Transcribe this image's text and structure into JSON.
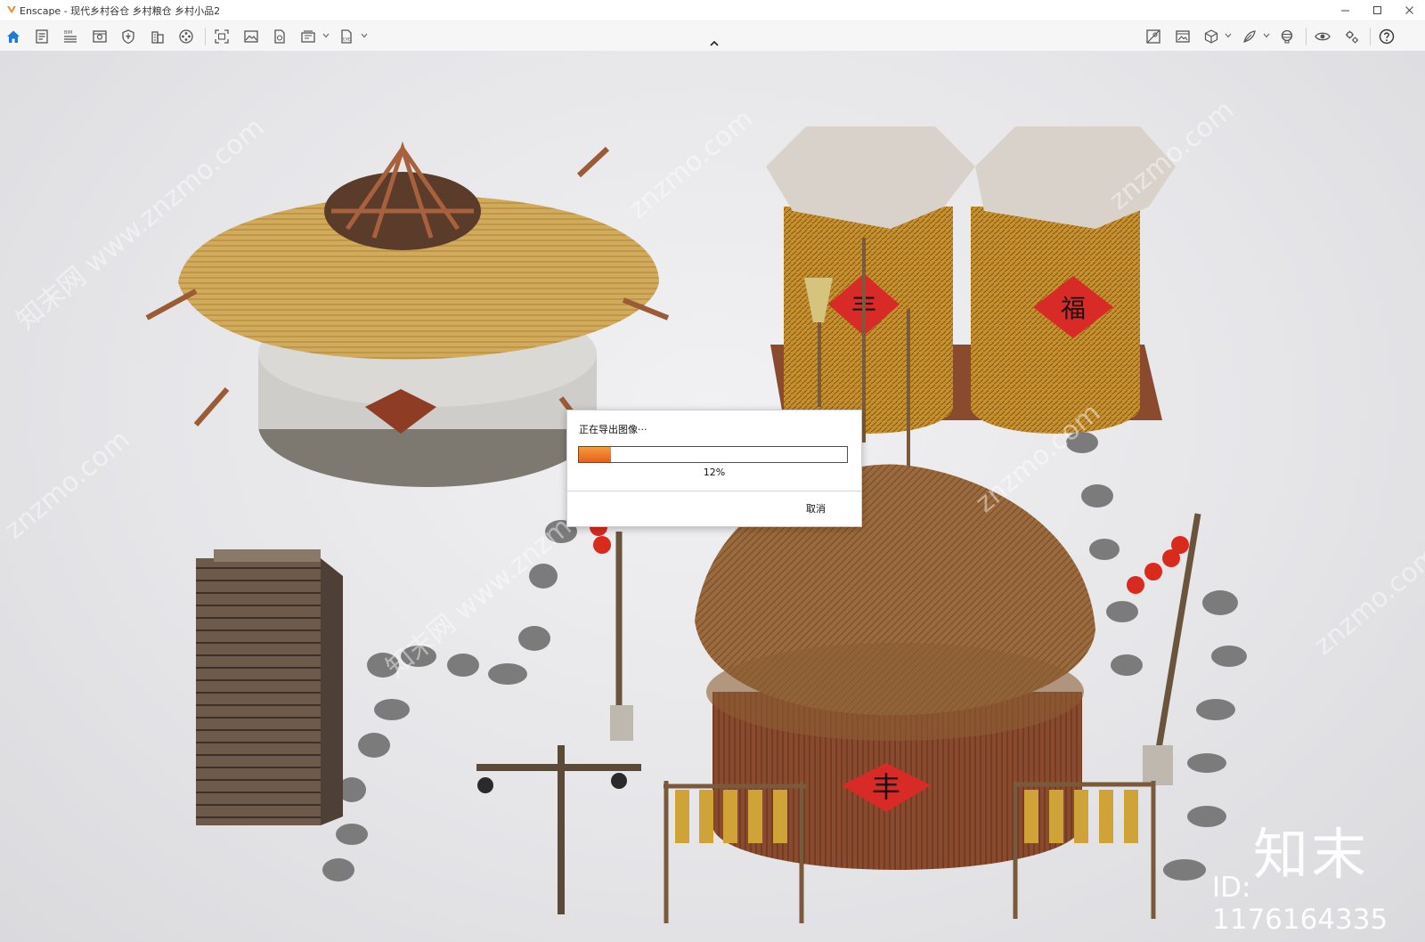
{
  "window": {
    "title": "Enscape - 现代乡村谷仓 乡村粮仓 乡村小品2",
    "controls": [
      "minimize-icon",
      "maximize-icon",
      "close-icon"
    ]
  },
  "toolbar": {
    "left_tools": [
      {
        "name": "home-icon",
        "active": true
      },
      {
        "name": "document-list-icon"
      },
      {
        "name": "bim-icon",
        "label": "BIM"
      },
      {
        "name": "view-preview-icon"
      },
      {
        "name": "shield-asset-icon"
      },
      {
        "name": "building-icon"
      },
      {
        "name": "video-reel-icon"
      },
      {
        "name": "screenshot-frame-icon"
      },
      {
        "name": "image-export-icon"
      },
      {
        "name": "document-export-icon"
      },
      {
        "name": "batch-render-icon",
        "has_dropdown": true
      },
      {
        "name": "exe-export-icon",
        "label": "EXE",
        "has_dropdown": true
      }
    ],
    "right_tools": [
      {
        "name": "hide-objects-icon"
      },
      {
        "name": "image-gallery-icon"
      },
      {
        "name": "cube-view-icon",
        "has_dropdown": true
      },
      {
        "name": "feather-leaf-icon",
        "has_dropdown": true
      },
      {
        "name": "vr-headset-icon"
      },
      {
        "name": "eye-visibility-icon"
      },
      {
        "name": "settings-gears-icon"
      },
      {
        "name": "help-icon"
      }
    ],
    "accent_color": "#1a7cd6"
  },
  "dialog": {
    "title": "正在导出图像···",
    "progress": 0.12,
    "progress_text": "12%",
    "cancel_label": "取消",
    "fill_color": "#ef7a2a"
  },
  "watermarks": {
    "diagonal_text": "知末网 www.znzmo.com",
    "short_text": "znzmo.com",
    "brand": "知末",
    "id_text": "ID: 1176164335"
  },
  "scene": {
    "description_labels": {
      "granary_sign_left": "丰",
      "granary_sign_right": "福",
      "hut_sign": "丰"
    }
  }
}
